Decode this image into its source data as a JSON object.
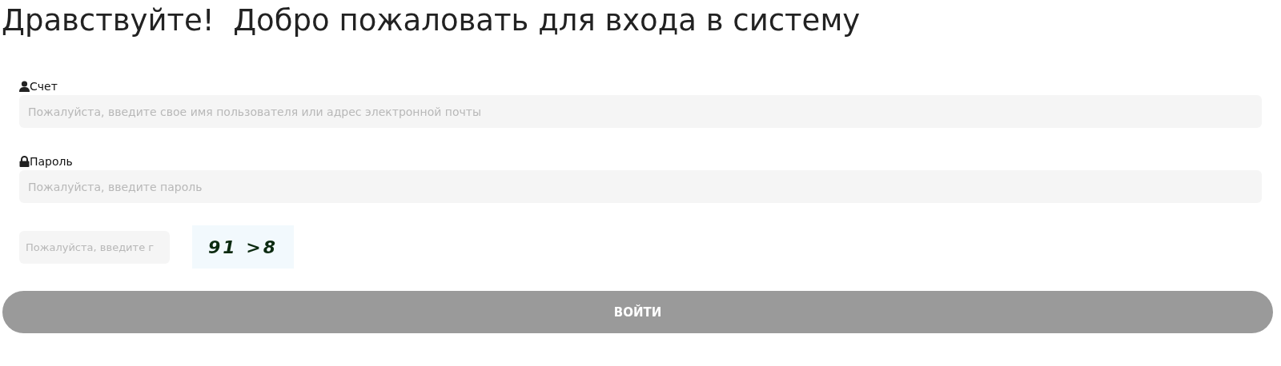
{
  "title": "Дравствуйте!  Добро пожаловать для входа в систему",
  "fields": [
    {
      "kind": "account",
      "label": "Счет",
      "placeholder": "Пожалуйста, введите свое имя пользователя или адрес электронной почты"
    },
    {
      "kind": "password",
      "label": "Пароль",
      "placeholder": "Пожалуйста, введите пароль"
    }
  ],
  "captcha": {
    "placeholder": "Пожалуйста, введите г",
    "code": "91 >8"
  },
  "button": "ВОЙТИ"
}
